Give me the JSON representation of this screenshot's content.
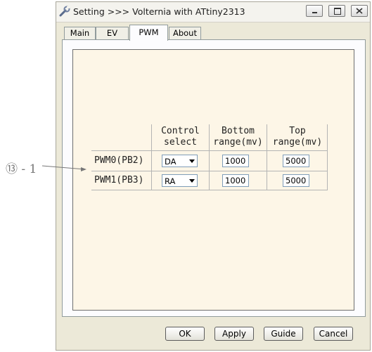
{
  "window": {
    "title": "Setting >>> Volternia with ATtiny2313",
    "icon": "wrench-icon",
    "controls": [
      "minimize-icon",
      "maximize-icon",
      "close-icon"
    ]
  },
  "tabs": [
    {
      "label": "Main",
      "active": false
    },
    {
      "label": "EV",
      "active": false
    },
    {
      "label": "PWM",
      "active": true
    },
    {
      "label": "About",
      "active": false
    }
  ],
  "table": {
    "headers": {
      "control_1": "Control",
      "control_2": "select",
      "bottom_1": "Bottom",
      "bottom_2": "range(mv)",
      "top_1": "Top",
      "top_2": "range(mv)"
    },
    "rows": [
      {
        "label": "PWM0(PB2)",
        "control": "DA",
        "bottom": "1000",
        "top": "5000"
      },
      {
        "label": "PWM1(PB3)",
        "control": "RA",
        "bottom": "1000",
        "top": "5000"
      }
    ]
  },
  "buttons": {
    "ok": "OK",
    "apply": "Apply",
    "guide": "Guide",
    "cancel": "Cancel"
  },
  "annotation": "⑬ - 1",
  "colors": {
    "panel_bg": "#fdf6e7",
    "window_bg": "#ece9d8",
    "annotation": "#777777"
  }
}
